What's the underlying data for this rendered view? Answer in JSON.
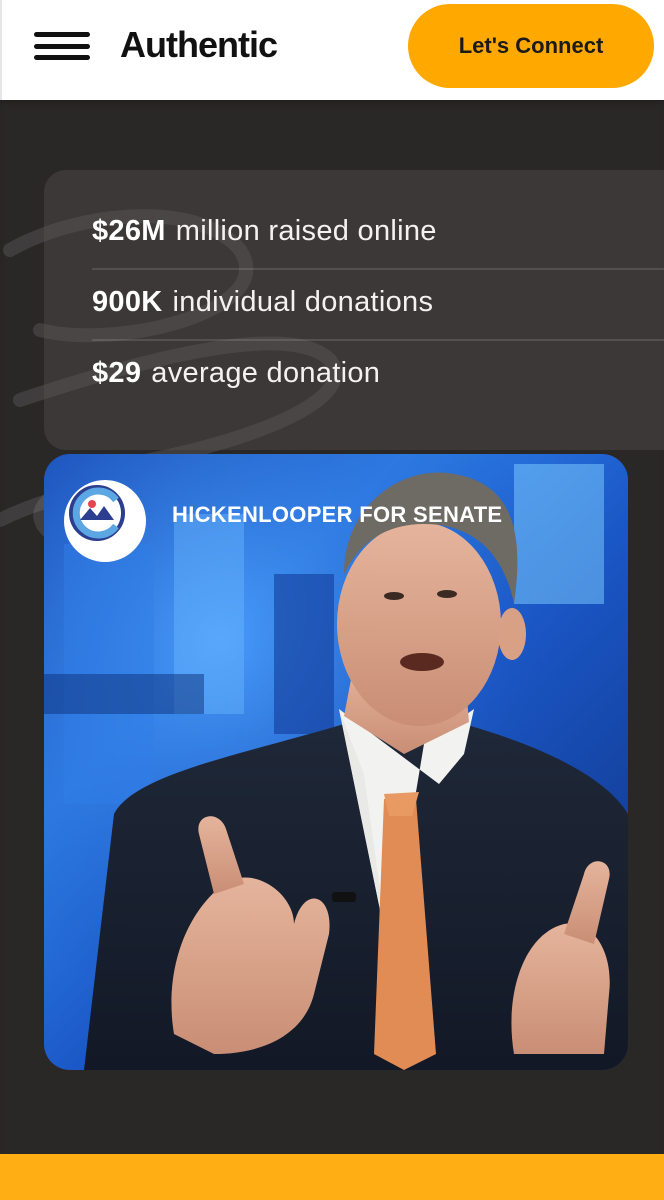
{
  "header": {
    "logo_text": "Authentic",
    "cta_label": "Let's Connect",
    "menu_icon": "hamburger-menu-icon"
  },
  "stats": [
    {
      "value": "$26M",
      "label": "million raised online"
    },
    {
      "value": "900K",
      "label": "individual donations"
    },
    {
      "value": "$29",
      "label": "average donation"
    }
  ],
  "case_card": {
    "title": "HICKENLOOPER FOR SENATE",
    "logo_icon": "colorado-c-mountain-logo-icon",
    "image_subject": "man-in-suit-speaking-photo"
  },
  "colors": {
    "accent": "#ffa800",
    "dark_bg": "#2a2727",
    "footer": "#ffae14"
  }
}
